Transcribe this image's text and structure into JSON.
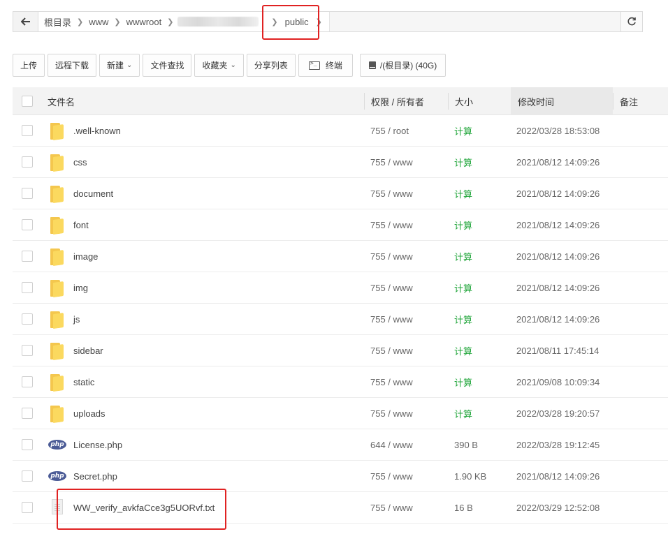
{
  "breadcrumb": {
    "items": [
      "根目录",
      "www",
      "wwwroot",
      "public"
    ]
  },
  "toolbar": {
    "upload": "上传",
    "remote_download": "远程下载",
    "new": "新建",
    "file_search": "文件查找",
    "favorites": "收藏夹",
    "share_list": "分享列表",
    "terminal": "终端",
    "disk": "/(根目录) (40G)"
  },
  "table": {
    "headers": {
      "name": "文件名",
      "perm": "权限 / 所有者",
      "size": "大小",
      "mtime": "修改时间",
      "note": "备注"
    },
    "rows": [
      {
        "type": "folder",
        "name": ".well-known",
        "perm": "755 / root",
        "size": "计算",
        "mtime": "2022/03/28 18:53:08"
      },
      {
        "type": "folder",
        "name": "css",
        "perm": "755 / www",
        "size": "计算",
        "mtime": "2021/08/12 14:09:26"
      },
      {
        "type": "folder",
        "name": "document",
        "perm": "755 / www",
        "size": "计算",
        "mtime": "2021/08/12 14:09:26"
      },
      {
        "type": "folder",
        "name": "font",
        "perm": "755 / www",
        "size": "计算",
        "mtime": "2021/08/12 14:09:26"
      },
      {
        "type": "folder",
        "name": "image",
        "perm": "755 / www",
        "size": "计算",
        "mtime": "2021/08/12 14:09:26"
      },
      {
        "type": "folder",
        "name": "img",
        "perm": "755 / www",
        "size": "计算",
        "mtime": "2021/08/12 14:09:26"
      },
      {
        "type": "folder",
        "name": "js",
        "perm": "755 / www",
        "size": "计算",
        "mtime": "2021/08/12 14:09:26"
      },
      {
        "type": "folder",
        "name": "sidebar",
        "perm": "755 / www",
        "size": "计算",
        "mtime": "2021/08/11 17:45:14"
      },
      {
        "type": "folder",
        "name": "static",
        "perm": "755 / www",
        "size": "计算",
        "mtime": "2021/09/08 10:09:34"
      },
      {
        "type": "folder",
        "name": "uploads",
        "perm": "755 / www",
        "size": "计算",
        "mtime": "2022/03/28 19:20:57"
      },
      {
        "type": "php",
        "name": "License.php",
        "perm": "644 / www",
        "size": "390 B",
        "mtime": "2022/03/28 19:12:45"
      },
      {
        "type": "php",
        "name": "Secret.php",
        "perm": "755 / www",
        "size": "1.90 KB",
        "mtime": "2021/08/12 14:09:26"
      },
      {
        "type": "txt",
        "name": "WW_verify_avkfaCce3g5UORvf.txt",
        "perm": "755 / www",
        "size": "16 B",
        "mtime": "2022/03/29 12:52:08"
      }
    ]
  },
  "icons": {
    "back": "arrow-left-icon",
    "refresh": "refresh-icon",
    "folder": "folder-icon",
    "php": "php-file-icon",
    "txt": "text-file-icon",
    "terminal": "terminal-icon",
    "disk": "disk-icon"
  },
  "colors": {
    "calc": "#20a53a",
    "highlight": "#e02222",
    "php_badge": "#4b5b96"
  },
  "php_badge_text": "php"
}
